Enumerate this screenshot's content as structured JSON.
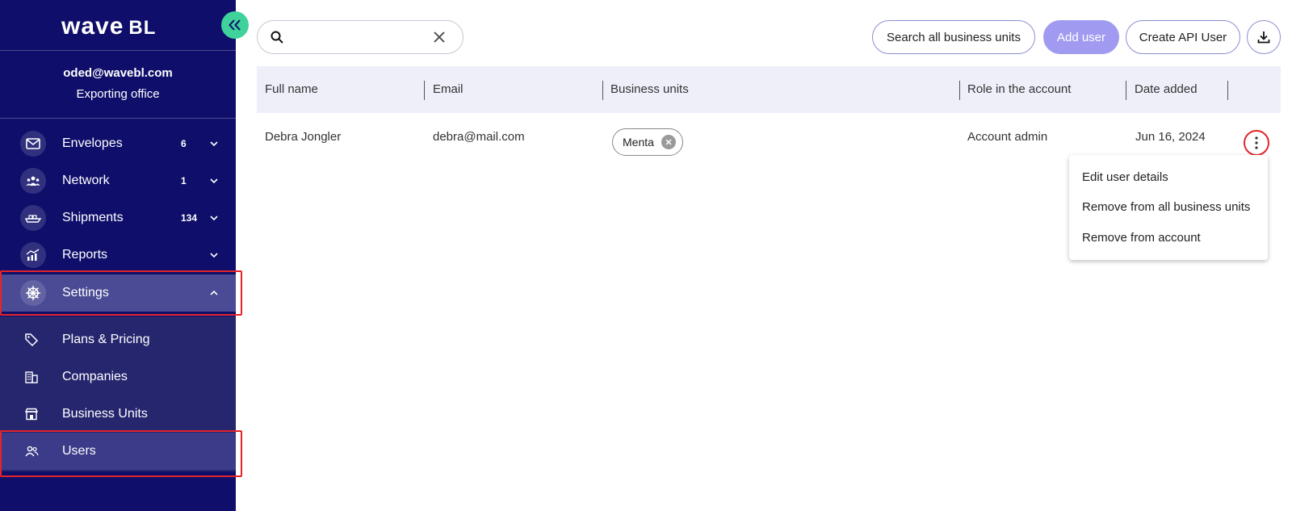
{
  "sidebar": {
    "logo": "wave",
    "logo_suffix": "BL",
    "user_email": "oded@wavebl.com",
    "user_office": "Exporting office",
    "nav": [
      {
        "label": "Envelopes",
        "count": "6",
        "icon": "envelope-icon"
      },
      {
        "label": "Network",
        "count": "1",
        "icon": "network-icon"
      },
      {
        "label": "Shipments",
        "count": "134",
        "icon": "ship-icon"
      },
      {
        "label": "Reports",
        "count": "",
        "icon": "reports-icon"
      },
      {
        "label": "Settings",
        "count": "",
        "icon": "helm-icon"
      }
    ],
    "submenu": [
      {
        "label": "Plans & Pricing",
        "icon": "tag-icon"
      },
      {
        "label": "Companies",
        "icon": "building-icon"
      },
      {
        "label": "Business Units",
        "icon": "store-icon"
      },
      {
        "label": "Users",
        "icon": "users-icon"
      }
    ]
  },
  "toolbar": {
    "search_value": "",
    "search_all": "Search all business units",
    "add_user": "Add user",
    "create_api_user": "Create API User"
  },
  "table": {
    "columns": [
      "Full name",
      "Email",
      "Business units",
      "Role in the account",
      "Date added"
    ],
    "rows": [
      {
        "name": "Debra Jongler",
        "email": "debra@mail.com",
        "unit": "Menta",
        "role": "Account admin",
        "date": "Jun 16, 2024"
      }
    ]
  },
  "row_menu": [
    "Edit user details",
    "Remove from all business units",
    "Remove from account"
  ],
  "colors": {
    "sidebar": "#0f0f6b",
    "accent": "#3fd39b",
    "primary": "#a09bf0",
    "highlight": "#e3242b"
  }
}
